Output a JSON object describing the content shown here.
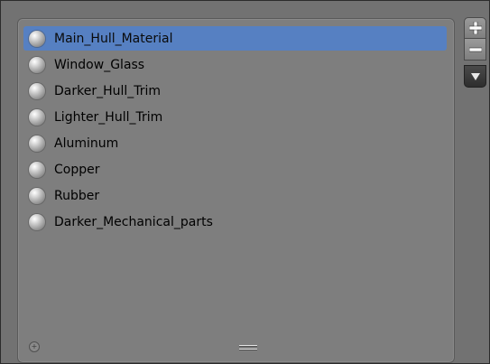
{
  "materials": {
    "items": [
      {
        "name": "Main_Hull_Material",
        "selected": true
      },
      {
        "name": "Window_Glass",
        "selected": false
      },
      {
        "name": "Darker_Hull_Trim",
        "selected": false
      },
      {
        "name": "Lighter_Hull_Trim",
        "selected": false
      },
      {
        "name": "Aluminum",
        "selected": false
      },
      {
        "name": "Copper",
        "selected": false
      },
      {
        "name": "Rubber",
        "selected": false
      },
      {
        "name": "Darker_Mechanical_parts",
        "selected": false
      }
    ]
  },
  "icons": {
    "material": "material-sphere-icon",
    "add": "plus-icon",
    "remove": "minus-icon",
    "specials": "down-arrow-icon",
    "filter": "filter-options-icon",
    "resize": "resize-grip-icon"
  },
  "colors": {
    "selection": "#5680c2",
    "panel": "#7e7e7e",
    "background": "#727272"
  }
}
